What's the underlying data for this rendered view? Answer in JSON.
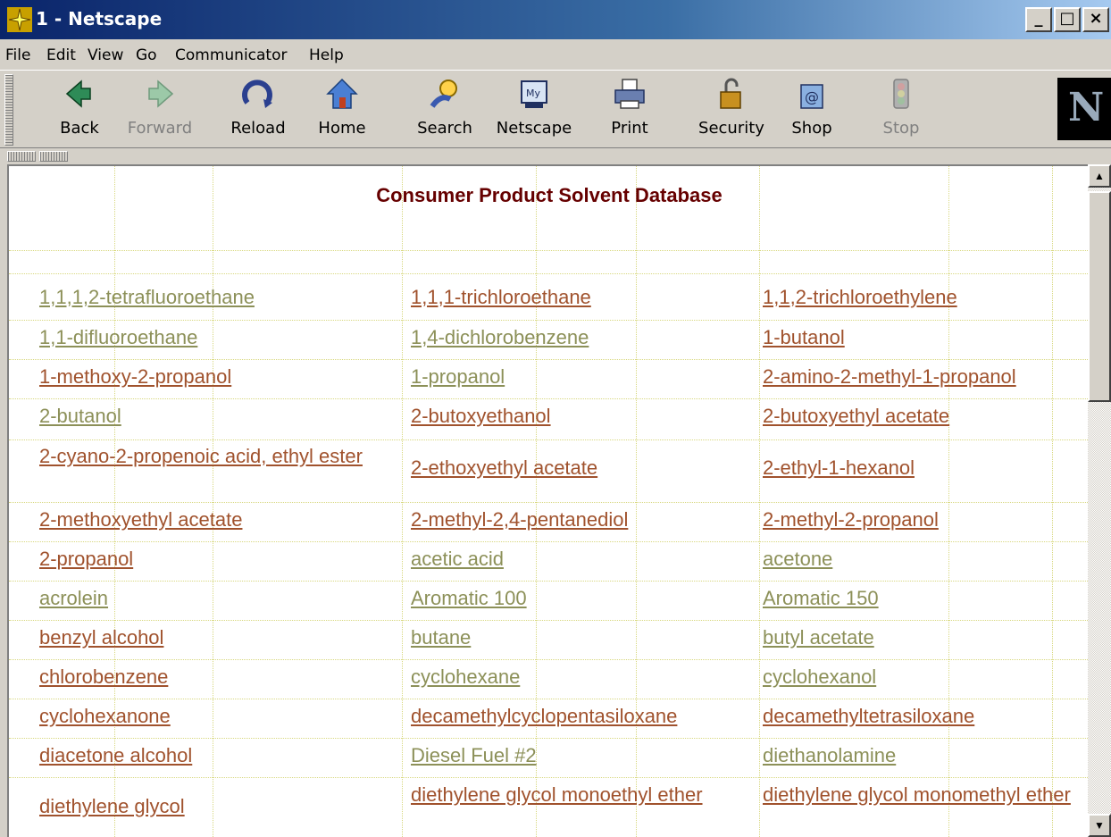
{
  "window": {
    "title": "1 - Netscape"
  },
  "window_buttons": {
    "minimize": "_",
    "maximize": "□",
    "close": "×"
  },
  "menu": [
    "File",
    "Edit",
    "View",
    "Go",
    "Communicator",
    "Help"
  ],
  "toolbar": [
    {
      "label": "Back",
      "icon": "back-arrow-icon",
      "enabled": true
    },
    {
      "label": "Forward",
      "icon": "forward-arrow-icon",
      "enabled": false
    },
    {
      "label": "Reload",
      "icon": "reload-icon",
      "enabled": true
    },
    {
      "label": "Home",
      "icon": "home-icon",
      "enabled": true
    },
    {
      "label": "Search",
      "icon": "search-icon",
      "enabled": true
    },
    {
      "label": "Netscape",
      "icon": "my-netscape-icon",
      "enabled": true
    },
    {
      "label": "Print",
      "icon": "printer-icon",
      "enabled": true
    },
    {
      "label": "Security",
      "icon": "padlock-icon",
      "enabled": true
    },
    {
      "label": "Shop",
      "icon": "shop-icon",
      "enabled": true
    },
    {
      "label": "Stop",
      "icon": "stop-icon",
      "enabled": false
    }
  ],
  "brand": {
    "logo_letter": "N"
  },
  "page": {
    "title": "Consumer Product Solvent Database",
    "colors": {
      "title": "#660000",
      "link_visited": "#8c9058",
      "link_unvisited": "#a0522d",
      "background": "#ffffff"
    },
    "rows": [
      [
        {
          "text": "1,1,1,2-tetrafluoroethane",
          "visited": true
        },
        {
          "text": "1,1,1-trichloroethane",
          "visited": false
        },
        {
          "text": "1,1,2-trichloroethylene",
          "visited": false
        }
      ],
      [
        {
          "text": "1,1-difluoroethane",
          "visited": true
        },
        {
          "text": "1,4-dichlorobenzene",
          "visited": true
        },
        {
          "text": "1-butanol",
          "visited": false
        }
      ],
      [
        {
          "text": "1-methoxy-2-propanol",
          "visited": false
        },
        {
          "text": "1-propanol",
          "visited": true
        },
        {
          "text": "2-amino-2-methyl-1-propanol",
          "visited": false
        }
      ],
      [
        {
          "text": "2-butanol",
          "visited": true
        },
        {
          "text": "2-butoxyethanol",
          "visited": false
        },
        {
          "text": "2-butoxyethyl acetate",
          "visited": false
        }
      ],
      [
        {
          "text": "2-cyano-2-propenoic acid, ethyl ester",
          "visited": false
        },
        {
          "text": "2-ethoxyethyl acetate",
          "visited": false
        },
        {
          "text": "2-ethyl-1-hexanol",
          "visited": false
        }
      ],
      [
        {
          "text": "2-methoxyethyl acetate",
          "visited": false
        },
        {
          "text": "2-methyl-2,4-pentanediol",
          "visited": false
        },
        {
          "text": "2-methyl-2-propanol",
          "visited": false
        }
      ],
      [
        {
          "text": "2-propanol",
          "visited": false
        },
        {
          "text": "acetic acid",
          "visited": true
        },
        {
          "text": "acetone",
          "visited": true
        }
      ],
      [
        {
          "text": "acrolein",
          "visited": true
        },
        {
          "text": "Aromatic 100",
          "visited": true
        },
        {
          "text": "Aromatic 150",
          "visited": true
        }
      ],
      [
        {
          "text": "benzyl alcohol",
          "visited": false
        },
        {
          "text": "butane",
          "visited": true
        },
        {
          "text": "butyl acetate",
          "visited": true
        }
      ],
      [
        {
          "text": "chlorobenzene",
          "visited": false
        },
        {
          "text": "cyclohexane",
          "visited": true
        },
        {
          "text": "cyclohexanol",
          "visited": true
        }
      ],
      [
        {
          "text": "cyclohexanone",
          "visited": false
        },
        {
          "text": "decamethylcyclopentasiloxane",
          "visited": false
        },
        {
          "text": "decamethyltetrasiloxane",
          "visited": false
        }
      ],
      [
        {
          "text": "diacetone alcohol",
          "visited": false
        },
        {
          "text": "Diesel Fuel #2",
          "visited": true
        },
        {
          "text": "diethanolamine",
          "visited": true
        }
      ],
      [
        {
          "text": "diethylene glycol",
          "visited": false
        },
        {
          "text": "diethylene glycol monoethyl ether",
          "visited": false
        },
        {
          "text": "diethylene glycol monomethyl ether",
          "visited": false
        }
      ]
    ]
  }
}
